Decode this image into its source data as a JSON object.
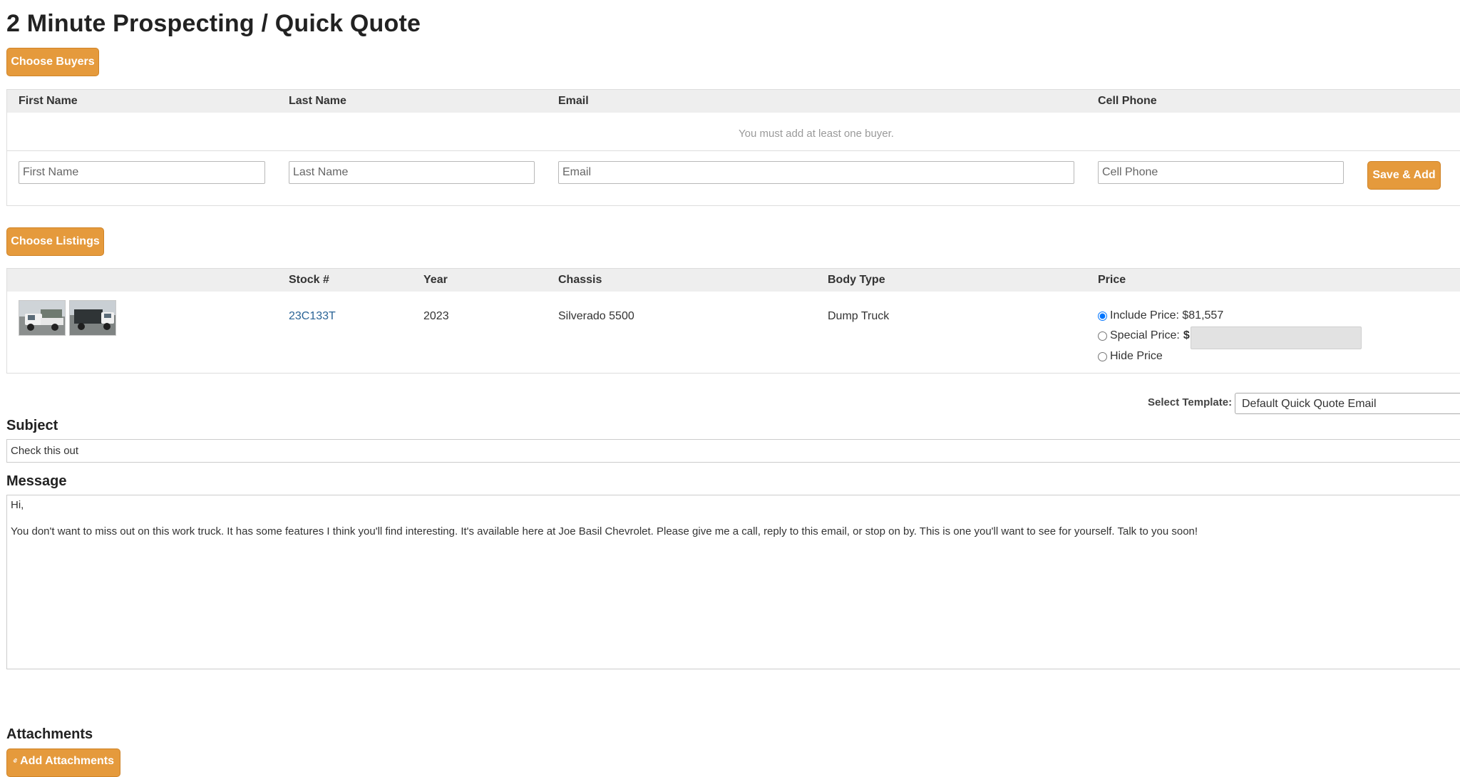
{
  "page": {
    "title": "2 Minute Prospecting / Quick Quote"
  },
  "buyers": {
    "choose_button": "Choose Buyers",
    "columns": [
      "First Name",
      "Last Name",
      "Email",
      "Cell Phone"
    ],
    "empty_notice": "You must add at least one buyer.",
    "inputs": {
      "first_name_placeholder": "First Name",
      "last_name_placeholder": "Last Name",
      "email_placeholder": "Email",
      "cell_phone_placeholder": "Cell Phone"
    },
    "save_button": "Save & Add"
  },
  "listings": {
    "choose_button": "Choose Listings",
    "columns": [
      "",
      "Stock #",
      "Year",
      "Chassis",
      "Body Type",
      "Price"
    ],
    "rows": [
      {
        "stock": "23C133T",
        "year": "2023",
        "chassis": "Silverado 5500",
        "body_type": "Dump Truck",
        "price_options": {
          "include": "Include Price: $81,557",
          "special": "Special Price:",
          "currency": "$",
          "hide": "Hide Price",
          "selected": "include"
        }
      }
    ]
  },
  "template": {
    "label": "Select Template:",
    "selected": "Default Quick Quote Email"
  },
  "subject": {
    "label": "Subject",
    "value": "Check this out"
  },
  "message": {
    "label": "Message",
    "greeting": "Hi,",
    "body": "You don't want to miss out on this work truck. It has some features I think you'll find interesting. It's available here at Joe Basil Chevrolet. Please give me a call, reply to this email, or stop on by. This is one you'll want to see for yourself. Talk to you soon!"
  },
  "attachments": {
    "label": "Attachments",
    "add_button": "Add Attachments",
    "add_icon": "paperclip-icon"
  },
  "colors": {
    "accent_button": "#e59a3c",
    "link": "#2a6496",
    "header_row": "#eeeeee"
  }
}
